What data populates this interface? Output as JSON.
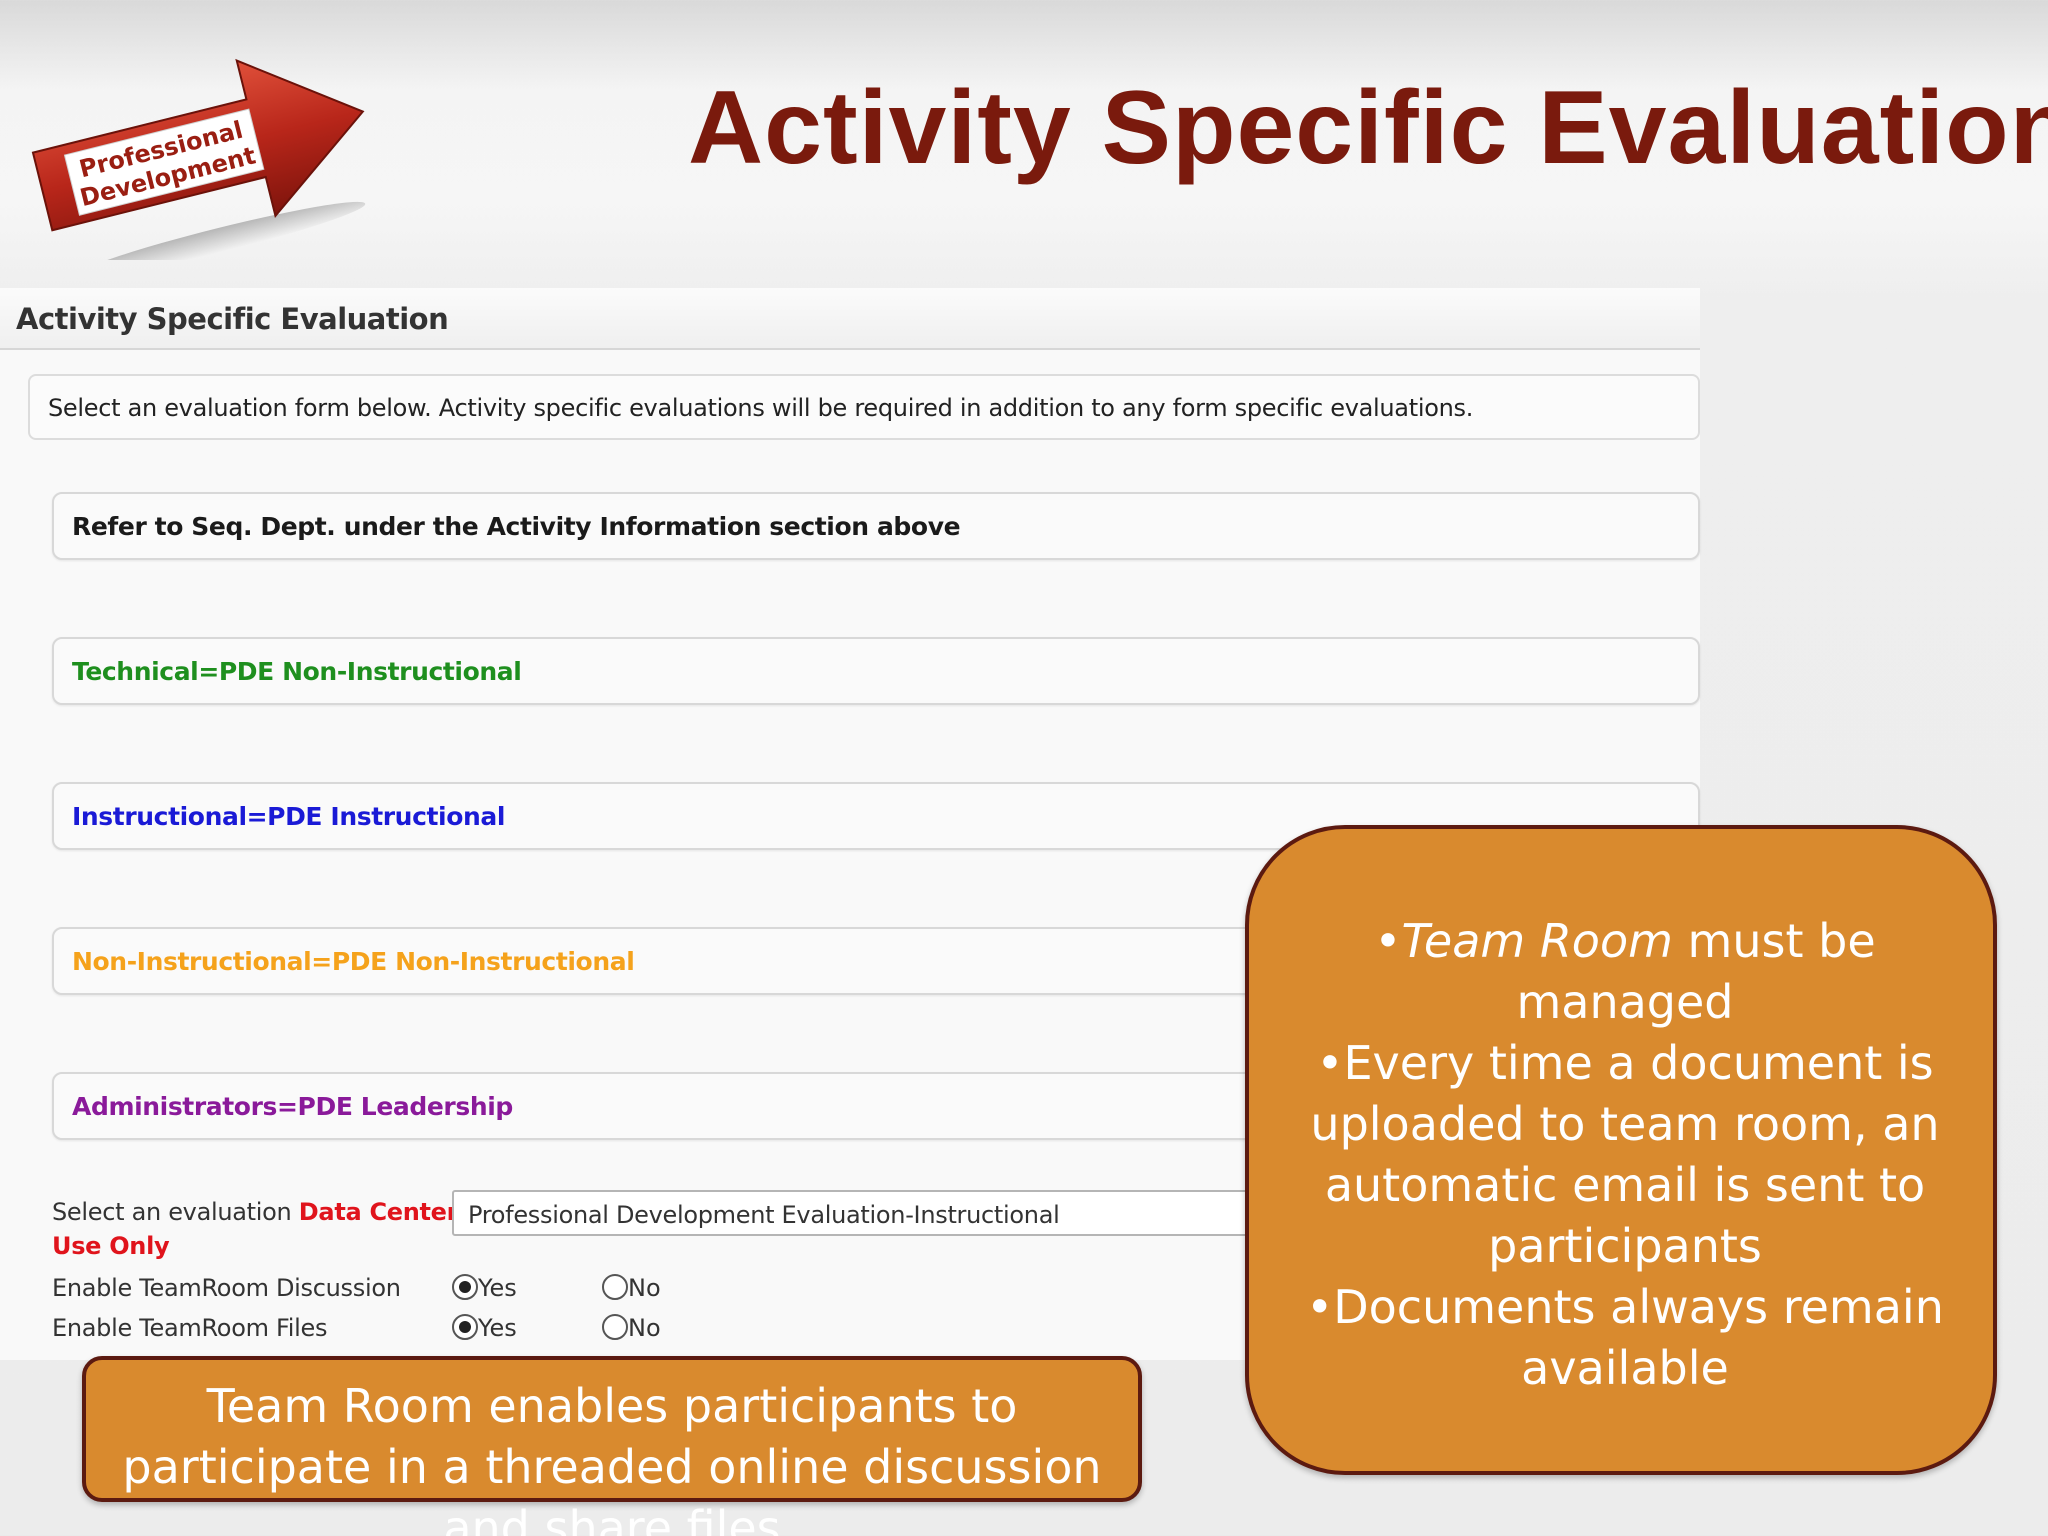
{
  "slide": {
    "title": "Activity Specific Evaluation",
    "logo_line1": "Professional",
    "logo_line2": "Development"
  },
  "panel": {
    "title": "Activity Specific Evaluation",
    "instruction": "Select an evaluation form below. Activity specific evaluations will be required in addition to any form specific evaluations.",
    "options": [
      {
        "label": "Refer to Seq. Dept. under the Activity Information section above",
        "color": "#1a1a1a"
      },
      {
        "label": "Technical=PDE Non-Instructional",
        "color": "#1e8f1e"
      },
      {
        "label": "Instructional=PDE Instructional",
        "color": "#1a1ad6"
      },
      {
        "label": "Non-Instructional=PDE Non-Instructional",
        "color": "#f5a21b"
      },
      {
        "label": "Administrators=PDE Leadership",
        "color": "#8a1a9a"
      }
    ],
    "select_label_prefix": "Select an evaluation",
    "select_label_red": "Data Center",
    "select_label_red2": "Use Only",
    "select_value": "Professional Development Evaluation-Instructional",
    "discussion_label": "Enable TeamRoom Discussion",
    "files_label": "Enable TeamRoom Files",
    "yes_label": "Yes",
    "no_label": "No",
    "discussion_value": "Yes",
    "files_value": "Yes"
  },
  "callout_right": {
    "bullet1_em": "Team Room",
    "bullet1_rest": " must be managed",
    "bullet2": "•Every time a document is uploaded to team room, an automatic email is sent to participants",
    "bullet3": "•Documents always remain available"
  },
  "callout_bottom": {
    "text": "Team Room enables participants to participate in a threaded online discussion and share files"
  }
}
